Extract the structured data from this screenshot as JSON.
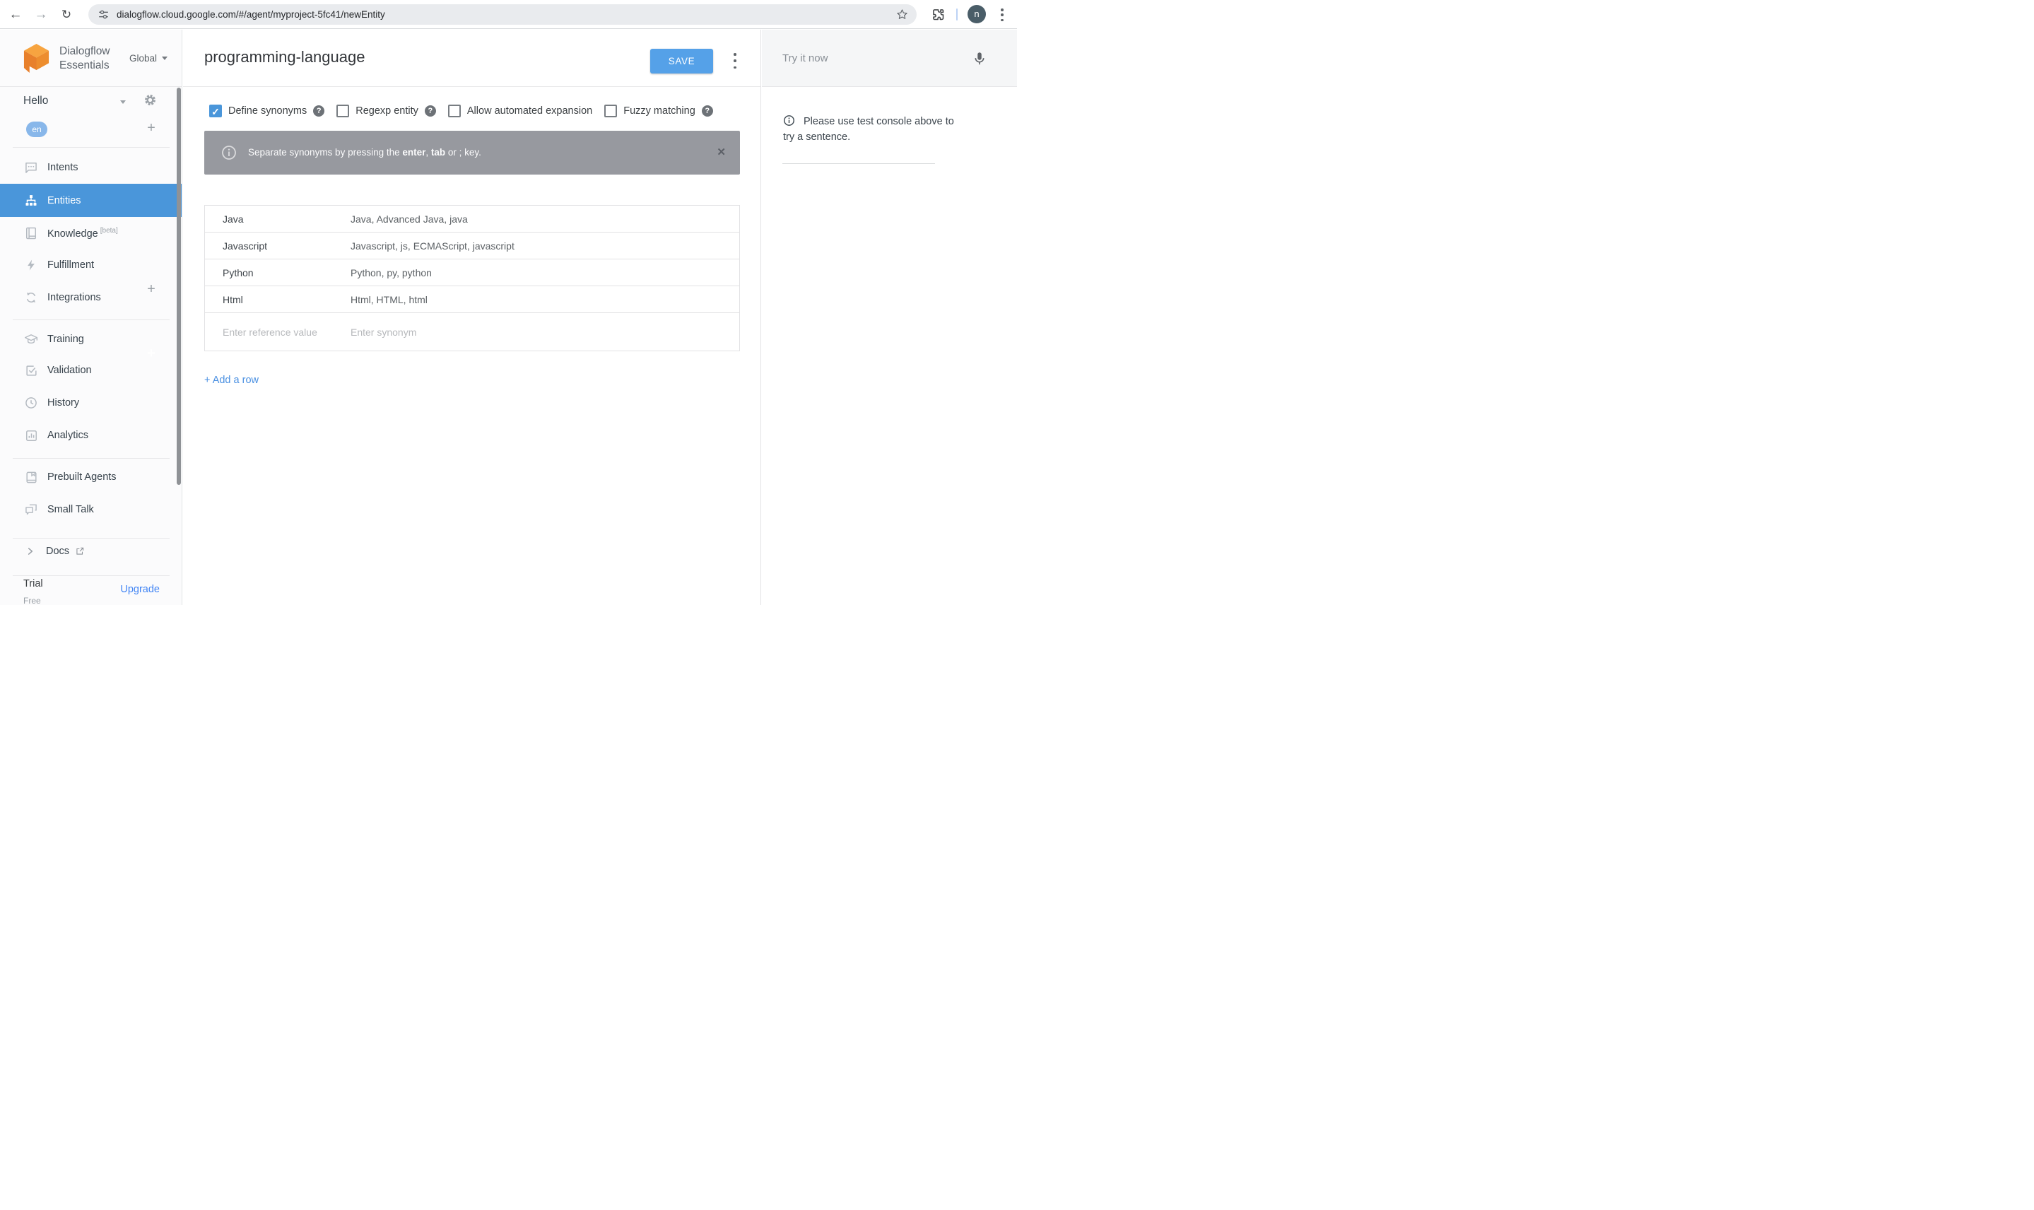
{
  "browser": {
    "url": "dialogflow.cloud.google.com/#/agent/myproject-5fc41/newEntity",
    "profile_initial": "n"
  },
  "sidebar": {
    "brand": {
      "line1": "Dialogflow",
      "line2": "Essentials"
    },
    "region_selector": "Global",
    "agent": {
      "name": "Hello",
      "language_badge": "en"
    },
    "items": [
      {
        "label": "Intents"
      },
      {
        "label": "Entities"
      },
      {
        "label": "Knowledge",
        "beta": "[beta]"
      },
      {
        "label": "Fulfillment"
      },
      {
        "label": "Integrations"
      },
      {
        "label": "Training"
      },
      {
        "label": "Validation"
      },
      {
        "label": "History"
      },
      {
        "label": "Analytics"
      },
      {
        "label": "Prebuilt Agents"
      },
      {
        "label": "Small Talk"
      }
    ],
    "docs_label": "Docs",
    "plan": {
      "tier": "Trial",
      "sub": "Free",
      "upgrade_label": "Upgrade"
    }
  },
  "header": {
    "entity_name": "programming-language",
    "save_label": "SAVE"
  },
  "options": [
    {
      "label": "Define synonyms",
      "checked": true,
      "help": true
    },
    {
      "label": "Regexp entity",
      "checked": false,
      "help": true
    },
    {
      "label": "Allow automated expansion",
      "checked": false,
      "help": false
    },
    {
      "label": "Fuzzy matching",
      "checked": false,
      "help": true
    }
  ],
  "banner": {
    "prefix": "Separate synonyms by pressing the ",
    "bold1": "enter",
    "mid": ", ",
    "bold2": "tab",
    "suffix": " or ; key."
  },
  "entity_table": {
    "rows": [
      {
        "reference": "Java",
        "synonyms": "Java, Advanced Java, java"
      },
      {
        "reference": "Javascript",
        "synonyms": "Javascript, js, ECMAScript, javascript"
      },
      {
        "reference": "Python",
        "synonyms": "Python, py, python"
      },
      {
        "reference": "Html",
        "synonyms": "Html, HTML, html"
      }
    ],
    "placeholders": {
      "reference": "Enter reference value",
      "synonym": "Enter synonym"
    }
  },
  "add_row_label": "+ Add a row",
  "test_console": {
    "placeholder": "Try it now",
    "info_text": "Please use test console above to try a sentence."
  },
  "colors": {
    "selected_nav_blue": "#4a96da",
    "save_button_blue": "#55a1e8",
    "banner_gray": "#97999f",
    "language_badge_blue": "#88b7ea",
    "upgrade_link_blue": "#4285f4",
    "add_row_blue": "#4a90e2",
    "logo_orange": "#f6a13d"
  }
}
